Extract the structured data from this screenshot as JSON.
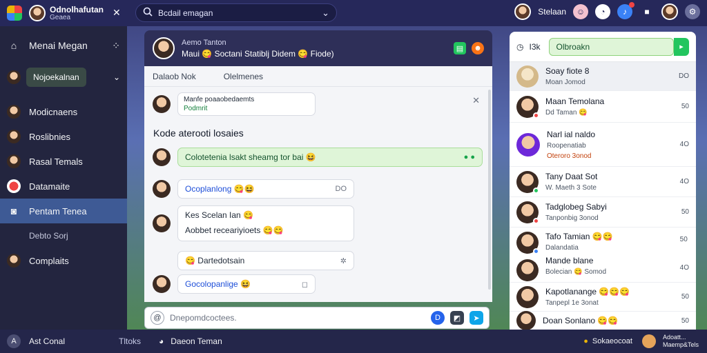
{
  "topbar": {
    "user_name": "Odnolhafutan",
    "user_sub": "Geaea",
    "search_text": "Bcdail emagan",
    "right_user": "Stelaan"
  },
  "sidebar": {
    "head_title": "Menai Megan",
    "chip_label": "Nojoekalnan",
    "items": [
      {
        "label": "Modicnaens"
      },
      {
        "label": "Roslibnies"
      },
      {
        "label": "Rasal Temals"
      },
      {
        "label": "Datamaite"
      },
      {
        "label": "Pentam Tenea"
      }
    ],
    "sub_item": "Debto Sorj",
    "last_item": "Complaits"
  },
  "chat": {
    "contact_name": "Aemo Tanton",
    "contact_status": "Maui 😋 Soctani Statiblj Didem 😋 Fiode)",
    "tabs": [
      "Dalaob Nok",
      "Olelmenes"
    ],
    "pinned_line1": "Manfe poaaobedaemts",
    "pinned_line2": "Podmrit",
    "section_title": "Kode aterooti losaies",
    "messages": [
      {
        "text": "Colotetenia lsakt sheamg tor bai 😆",
        "end": ""
      },
      {
        "text": "Ocoplanlong 😋😆",
        "end": "DO"
      },
      {
        "text": "Kes Scelan Ian 😋",
        "text2": "Aobbet receariyioets 😋😋"
      },
      {
        "text": "😋 Dartedotsain",
        "end": "✲"
      },
      {
        "text": "Gocolopanlige 😆",
        "end": "◻"
      }
    ],
    "composer_placeholder": "Dnepomdcoctees."
  },
  "right_panel": {
    "search_label": "I3k",
    "pill_text": "Olbroakn",
    "contacts": [
      {
        "name": "Soay fiote 8",
        "sub": "Moan Jomod",
        "time": "DO"
      },
      {
        "name": "Maan Temolana",
        "sub": "Dd Taman 😋",
        "time": "50"
      },
      {
        "name": "Narl ial naldo",
        "sub": "Roopenatiab",
        "time": "4O"
      },
      {
        "name": "",
        "sub": "Oteroro 3onod",
        "time": "50"
      },
      {
        "name": "Tany Daat Sot",
        "sub": "W. Maeth 3 Sote",
        "time": "4O"
      },
      {
        "name": "Tadglobeg Sabyi",
        "sub": "Tanponbig 3onod",
        "time": "50"
      },
      {
        "name": "Tafo Tamian 😋😋",
        "sub": "Dalandatia",
        "time": "50"
      },
      {
        "name": "Mande blane",
        "sub": "Bolecian 😋 Somod",
        "time": "4O"
      },
      {
        "name": "Kapotlanange 😋😋😋",
        "sub": "Tanpepl 1e 3onat",
        "time": "50"
      },
      {
        "name": "Doan Sonlano 😋😋",
        "sub": "",
        "time": "50"
      }
    ]
  },
  "bottombar": {
    "left_label": "Ast Conal",
    "mid_label": "Tltoks",
    "tab_label": "Daeon Teman",
    "right_status": "Sokaeocoat",
    "right_user_line1": "Adoatt...",
    "right_user_line2": "Maemp&Tels"
  },
  "colors": {
    "topbar": "#26285a",
    "sidebar": "#23253f",
    "accent_green": "#22c55e",
    "active_item": "#3e5a95"
  }
}
